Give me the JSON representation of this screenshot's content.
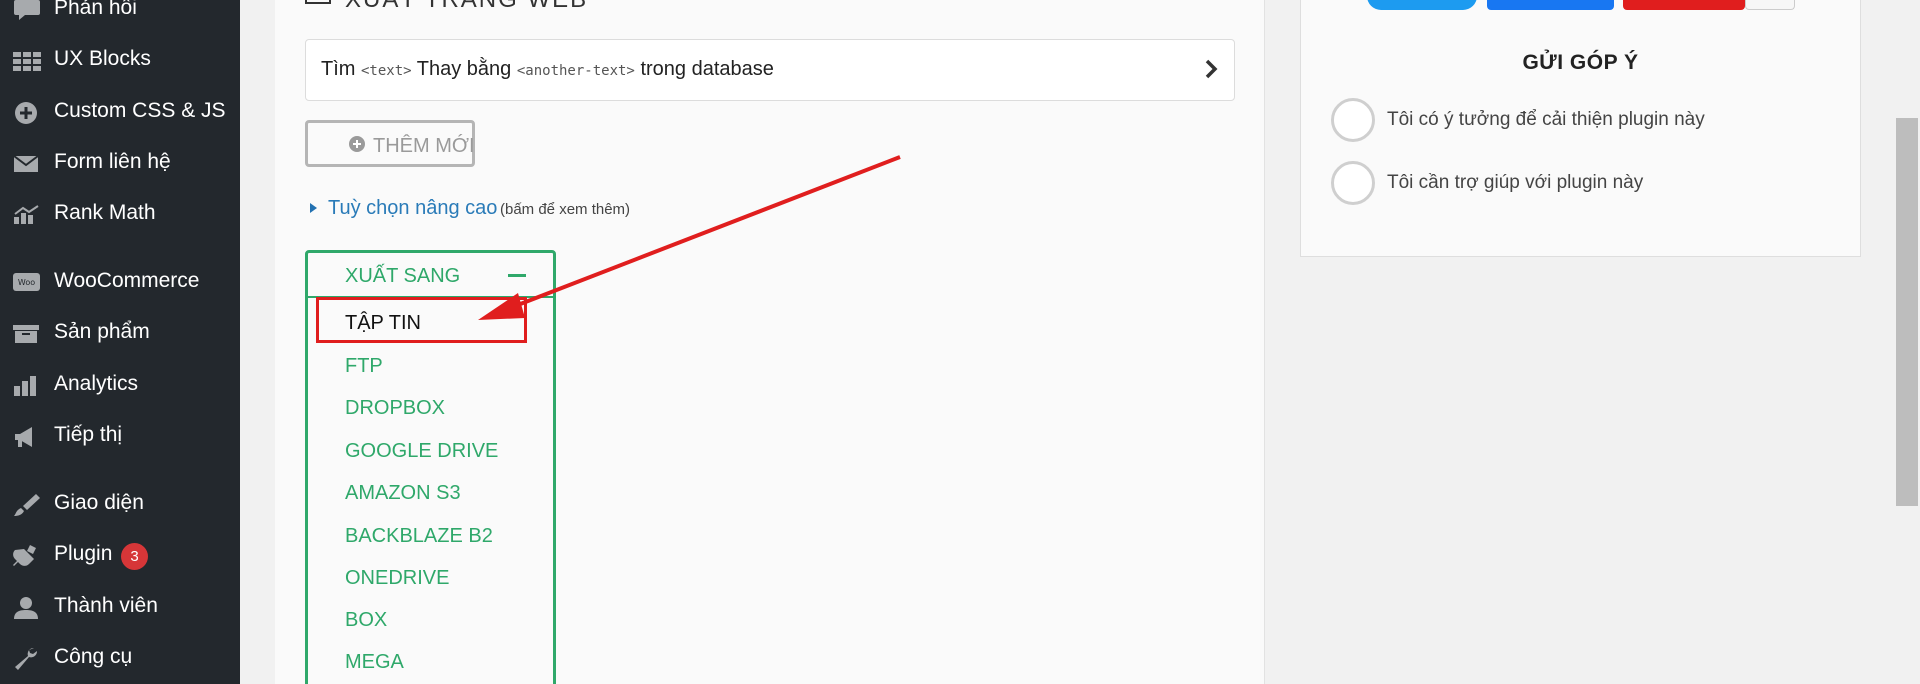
{
  "sidebar": {
    "items": [
      {
        "label": "Phản hồi",
        "icon": "comment-icon"
      },
      {
        "label": "UX Blocks",
        "icon": "grid-icon"
      },
      {
        "label": "Custom CSS & JS",
        "icon": "plus-circle-icon"
      },
      {
        "label": "Form liên hệ",
        "icon": "mail-icon"
      },
      {
        "label": "Rank Math",
        "icon": "chart-icon"
      },
      {
        "label": "WooCommerce",
        "icon": "woo-icon"
      },
      {
        "label": "Sản phẩm",
        "icon": "archive-icon"
      },
      {
        "label": "Analytics",
        "icon": "bar-chart-icon"
      },
      {
        "label": "Tiếp thị",
        "icon": "megaphone-icon"
      },
      {
        "label": "Giao diện",
        "icon": "paintbrush-icon"
      },
      {
        "label": "Plugin",
        "icon": "plugin-icon",
        "badge": "3"
      },
      {
        "label": "Thành viên",
        "icon": "user-icon"
      },
      {
        "label": "Công cụ",
        "icon": "wrench-icon"
      }
    ]
  },
  "main": {
    "section_title": "XUẤT TRANG WEB",
    "rule": {
      "prefix": "Tìm",
      "find_token": "<text>",
      "middle": "Thay bằng",
      "replace_token": "<another-text>",
      "suffix": "trong database"
    },
    "add_button_label": "THÊM MỚI",
    "advanced": {
      "label": "Tuỳ chọn nâng cao",
      "hint": "(bấm để xem thêm)"
    },
    "export": {
      "header": "XUẤT SANG",
      "options": [
        "TẬP TIN",
        "FTP",
        "DROPBOX",
        "GOOGLE DRIVE",
        "AMAZON S3",
        "BACKBLAZE B2",
        "ONEDRIVE",
        "BOX",
        "MEGA"
      ],
      "selected": "TẬP TIN"
    }
  },
  "feedback": {
    "title": "GỬI GÓP Ý",
    "options": [
      "Tôi có ý tưởng để cải thiện plugin này",
      "Tôi cần trợ giúp với plugin này"
    ]
  },
  "colors": {
    "sidebar_bg": "#23282d",
    "accent_green": "#2fa86a",
    "link_blue": "#2a7bb8",
    "annotation_red": "#e01e1e",
    "badge_red": "#d63638"
  }
}
